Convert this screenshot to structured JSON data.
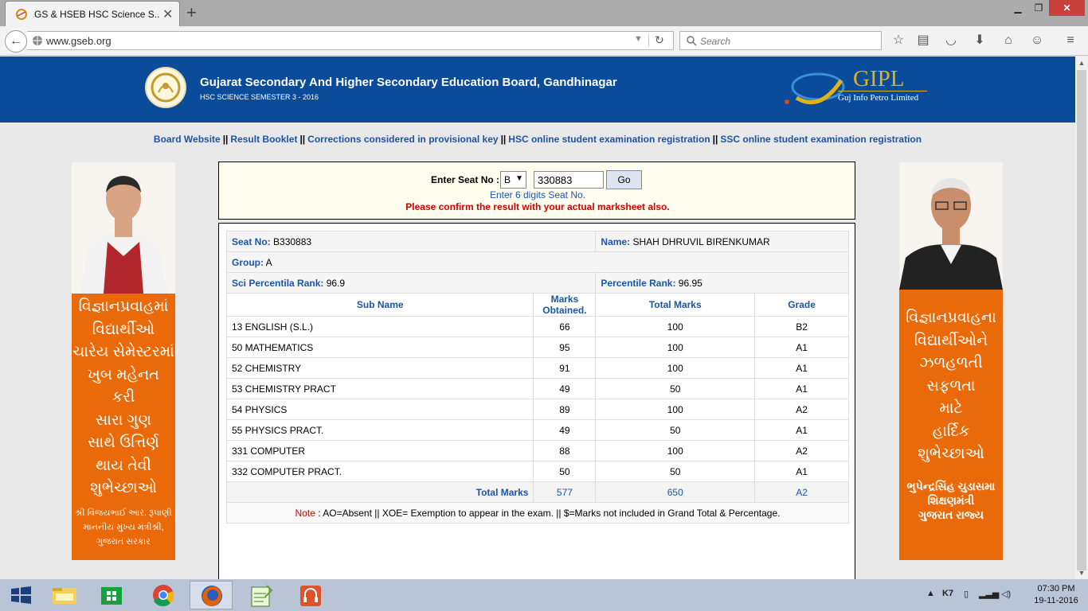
{
  "browser": {
    "tab_title": "GS & HSEB HSC Science S...",
    "url": "www.gseb.org",
    "search_placeholder": "Search"
  },
  "header": {
    "title": "Gujarat Secondary And Higher Secondary Education Board, Gandhinagar",
    "subtitle": "HSC SCIENCE SEMESTER 3 - 2016",
    "partner_name": "GIPL",
    "partner_sub": "Guj Info Petro Limited"
  },
  "links": [
    "Board Website",
    "Result Booklet",
    "Corrections considered in provisional key",
    "HSC online student examination registration",
    "SSC online student examination registration"
  ],
  "links_sep": "||",
  "left_banner": {
    "lines": [
      "વિજ્ઞાનપ્રવાહમાં",
      "વિદ્યાર્થીઓ",
      "ચારેય સેમેસ્ટરમાં",
      "ખુબ મહેનત",
      "કરી",
      "સારા ગુણ",
      "સાથે ઉત્તિર્ણ",
      "થાય તેવી",
      "શુભેચ્છાઓ"
    ],
    "sig": [
      "શ્રી વિજયભાઈ આર. રૂપાણી",
      "માનનીય મુખ્ય મંત્રીશ્રી,",
      "ગુજરાત સરકાર"
    ]
  },
  "right_banner": {
    "lines": [
      "વિજ્ઞાનપ્રવાહના",
      "વિદ્યાર્થીઓને",
      "ઝળહળતી",
      "સફળતા",
      "માટે",
      "હાર્દિક",
      "શુભેચ્છાઓ"
    ],
    "sig": [
      "ભુપેન્દ્રસિંહ ચુડાસમા",
      "શિક્ષણમંત્રી",
      "ગુજરાત રાજ્ય"
    ]
  },
  "seat": {
    "label": "Enter Seat No :",
    "series": "B",
    "value": "330883",
    "go": "Go",
    "hint": "Enter 6 digits Seat No.",
    "warning": "Please confirm the result with your actual marksheet also."
  },
  "result": {
    "seat_label": "Seat No:",
    "seat_no": "B330883",
    "name_label": "Name:",
    "name": "SHAH DHRUVIL BIRENKUMAR",
    "group_label": "Group:",
    "group": "A",
    "sci_label": "Sci Percentila Rank:",
    "sci_rank": "96.9",
    "pr_label": "Percentile Rank:",
    "pr": "96.95",
    "cols": [
      "Sub Name",
      "Marks\nObtained.",
      "Total Marks",
      "Grade"
    ],
    "subjects": [
      {
        "name": "13 ENGLISH (S.L.)",
        "obt": "66",
        "tot": "100",
        "grade": "B2"
      },
      {
        "name": "50 MATHEMATICS",
        "obt": "95",
        "tot": "100",
        "grade": "A1"
      },
      {
        "name": "52 CHEMISTRY",
        "obt": "91",
        "tot": "100",
        "grade": "A1"
      },
      {
        "name": "53 CHEMISTRY PRACT",
        "obt": "49",
        "tot": "50",
        "grade": "A1"
      },
      {
        "name": "54 PHYSICS",
        "obt": "89",
        "tot": "100",
        "grade": "A2"
      },
      {
        "name": "55 PHYSICS PRACT.",
        "obt": "49",
        "tot": "50",
        "grade": "A1"
      },
      {
        "name": "331 COMPUTER",
        "obt": "88",
        "tot": "100",
        "grade": "A2"
      },
      {
        "name": "332 COMPUTER PRACT.",
        "obt": "50",
        "tot": "50",
        "grade": "A1"
      }
    ],
    "total_label": "Total Marks",
    "total_obt": "577",
    "total_tot": "650",
    "total_grade": "A2",
    "note_label": "Note",
    "note_text": ": AO=Absent || XOE= Exemption to appear in the exam. || $=Marks not included in Grand Total & Percentage."
  },
  "taskbar": {
    "time": "07:30 PM",
    "date": "19-11-2016"
  },
  "colors": {
    "header_bg": "#0a4b9a",
    "banner_orange": "#ea6a0a",
    "link_blue": "#1a56a8",
    "warn_red": "#d40000"
  }
}
